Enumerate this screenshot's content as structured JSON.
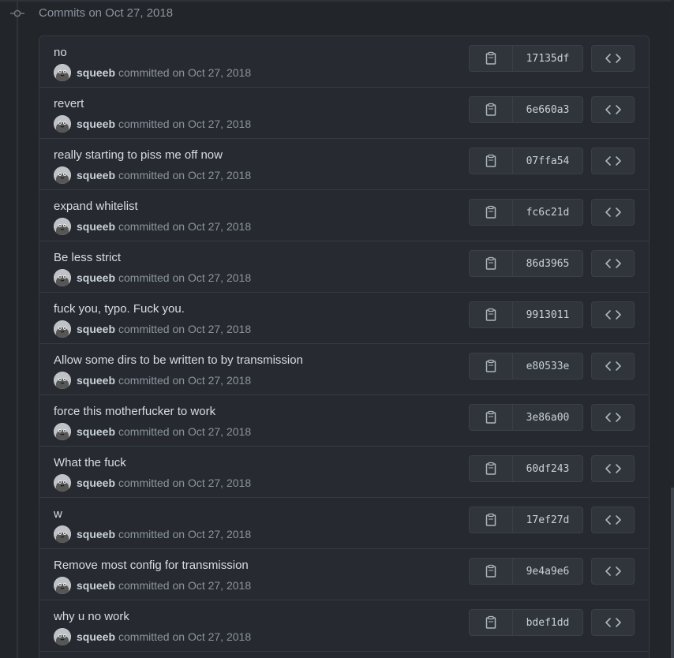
{
  "header": {
    "date_label": "Commits on Oct 27, 2018"
  },
  "commits": [
    {
      "message": "no",
      "author": "squeeb",
      "meta": "committed on Oct 27, 2018",
      "sha": "17135df"
    },
    {
      "message": "revert",
      "author": "squeeb",
      "meta": "committed on Oct 27, 2018",
      "sha": "6e660a3"
    },
    {
      "message": "really starting to piss me off now",
      "author": "squeeb",
      "meta": "committed on Oct 27, 2018",
      "sha": "07ffa54"
    },
    {
      "message": "expand whitelist",
      "author": "squeeb",
      "meta": "committed on Oct 27, 2018",
      "sha": "fc6c21d"
    },
    {
      "message": "Be less strict",
      "author": "squeeb",
      "meta": "committed on Oct 27, 2018",
      "sha": "86d3965"
    },
    {
      "message": "fuck you, typo. Fuck you.",
      "author": "squeeb",
      "meta": "committed on Oct 27, 2018",
      "sha": "9913011"
    },
    {
      "message": "Allow some dirs to be written to by transmission",
      "author": "squeeb",
      "meta": "committed on Oct 27, 2018",
      "sha": "e80533e"
    },
    {
      "message": "force this motherfucker to work",
      "author": "squeeb",
      "meta": "committed on Oct 27, 2018",
      "sha": "3e86a00"
    },
    {
      "message": "What the fuck",
      "author": "squeeb",
      "meta": "committed on Oct 27, 2018",
      "sha": "60df243"
    },
    {
      "message": "w",
      "author": "squeeb",
      "meta": "committed on Oct 27, 2018",
      "sha": "17ef27d"
    },
    {
      "message": "Remove most config for transmission",
      "author": "squeeb",
      "meta": "committed on Oct 27, 2018",
      "sha": "9e4a9e6"
    },
    {
      "message": "why u no work",
      "author": "squeeb",
      "meta": "committed on Oct 27, 2018",
      "sha": "bdef1dd"
    }
  ],
  "icons": {
    "timeline": "git-commit-icon",
    "copy": "clipboard-icon",
    "browse": "code-icon",
    "avatar": "avatar"
  },
  "colors": {
    "background": "#22262b",
    "row": "#262a30",
    "border": "#363b42",
    "button": "#30353b",
    "text": "#d7dde3",
    "muted": "#8b949e"
  }
}
